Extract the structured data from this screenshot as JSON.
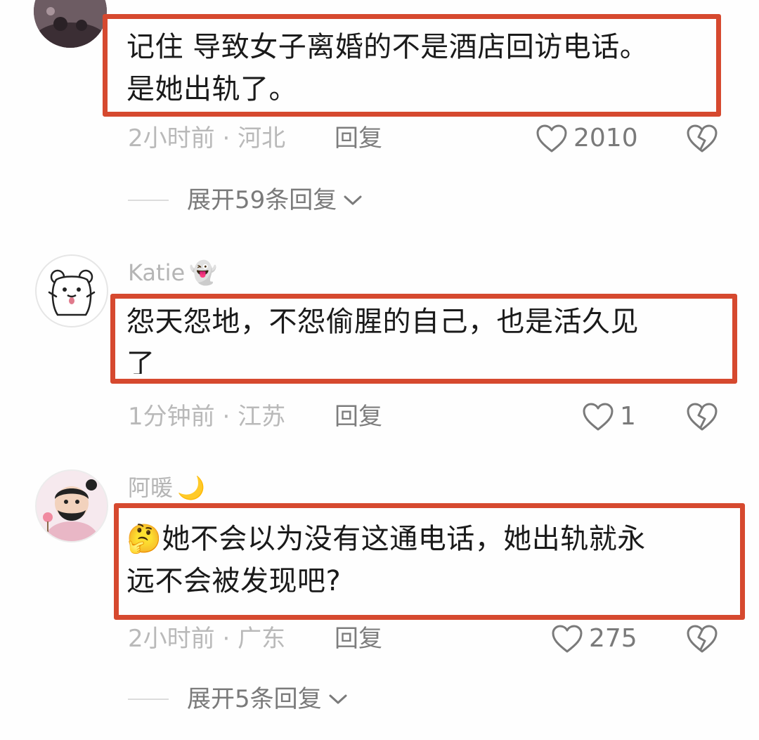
{
  "comments": [
    {
      "text_lines": [
        "记住 导致女子离婚的不是酒店回访电话。",
        "是她出轨了。"
      ],
      "time": "2小时前",
      "separator": "·",
      "location": "河北",
      "reply_label": "回复",
      "likes": "2010",
      "expand_label": "展开59条回复"
    },
    {
      "username": "Katie",
      "username_emoji": "👻",
      "text_lines": [
        "怨天怨地，不怨偷腥的自己，也是活久见",
        "了"
      ],
      "time": "1分钟前",
      "separator": "·",
      "location": "江苏",
      "reply_label": "回复",
      "likes": "1"
    },
    {
      "username": "阿暖",
      "username_emoji": "🌙",
      "text_emoji": "🤔",
      "text_lines": [
        "她不会以为没有这通电话，她出轨就永",
        "远不会被发现吧?"
      ],
      "time": "2小时前",
      "separator": "·",
      "location": "广东",
      "reply_label": "回复",
      "likes": "275",
      "expand_label": "展开5条回复"
    }
  ],
  "colors": {
    "highlight_border": "#d6492f",
    "meta_text": "#b9b9b9",
    "icon": "#7a7a7a"
  },
  "icons": {
    "like": "heart-outline-icon",
    "dislike": "broken-heart-icon",
    "expand": "chevron-down-icon"
  }
}
